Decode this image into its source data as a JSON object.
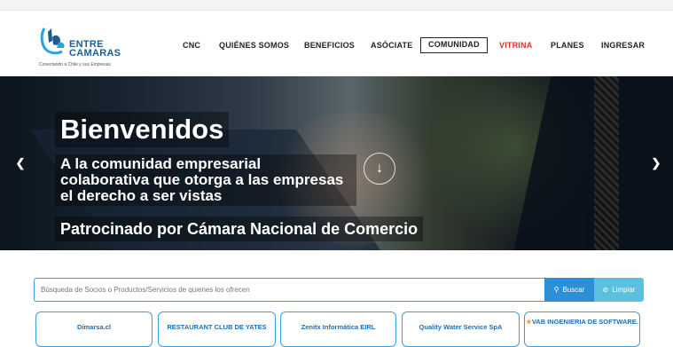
{
  "logo": {
    "line1": "ENTRE",
    "line2": "CAMARAS",
    "tagline": "Conectando a Chile y sus Empresas"
  },
  "nav": {
    "items": [
      {
        "label": "CNC"
      },
      {
        "label": "QUIÉNES SOMOS"
      },
      {
        "label": "BENEFICIOS"
      },
      {
        "label": "ASÓCIATE"
      },
      {
        "label": "COMUNIDAD"
      },
      {
        "label": "VITRINA"
      },
      {
        "label": "PLANES"
      },
      {
        "label": "INGRESAR"
      }
    ],
    "active_index": 4,
    "highlight_color": "#d9322d"
  },
  "hero": {
    "title": "Bienvenidos",
    "subtitle": "A la comunidad empresarial colaborativa que otorga a las empresas el derecho a ser vistas",
    "sponsor": "Patrocinado por Cámara Nacional de Comercio",
    "prev_icon": "chevron-left-icon",
    "next_icon": "chevron-right-icon",
    "scroll_icon": "arrow-down-icon"
  },
  "search": {
    "placeholder": "Búsqueda de Socios o Productos/Servicios de quienes los ofrecen",
    "value": "",
    "search_label": "Buscar",
    "clear_label": "Limpiar"
  },
  "results": [
    {
      "name": "Dimarsa.cl",
      "featured": false
    },
    {
      "name": "RESTAURANT CLUB DE YATES",
      "featured": false
    },
    {
      "name": "Zenitx Informática EIRL",
      "featured": false
    },
    {
      "name": "Quality Water Service SpA",
      "featured": false
    },
    {
      "name": "VAB INGENIERIA DE SOFTWARE.",
      "featured": true
    }
  ],
  "colors": {
    "brand_blue": "#1d5d8f",
    "button_blue": "#2d8fd5",
    "button_light": "#5bc0de",
    "card_border": "#3a9fd8"
  }
}
